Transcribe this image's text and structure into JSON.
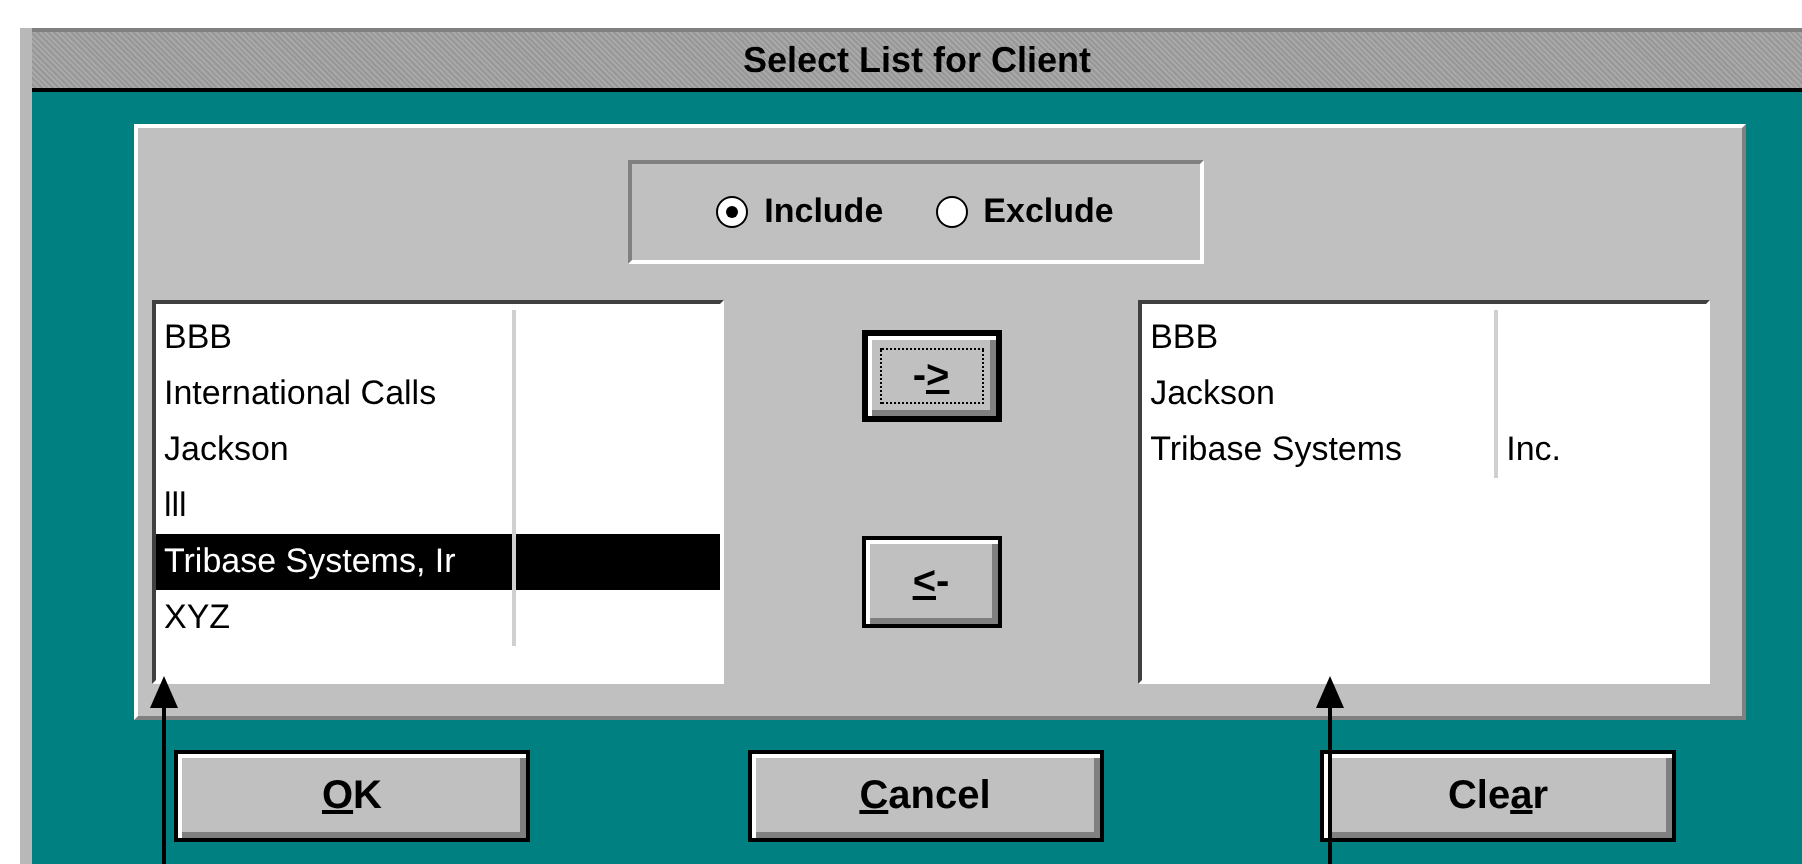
{
  "window": {
    "title": "Select List for Client"
  },
  "mode": [
    {
      "label": "Include",
      "selected": true
    },
    {
      "label": "Exclude",
      "selected": false
    }
  ],
  "available_list": {
    "rows": [
      {
        "column_1": "BBB",
        "selected": false
      },
      {
        "column_1": "International Calls",
        "selected": false
      },
      {
        "column_1": "Jackson",
        "selected": false
      },
      {
        "column_1": "lll",
        "selected": false
      },
      {
        "column_1": "Tribase Systems, Ir",
        "selected": true
      },
      {
        "column_1": "XYZ",
        "selected": false
      }
    ]
  },
  "move_buttons": [
    {
      "before": "-",
      "key": ">",
      "focused": true
    },
    {
      "key": "<",
      "after": "-",
      "focused": false
    }
  ],
  "selected_list": {
    "rows": [
      {
        "column_1": "BBB"
      },
      {
        "column_1": "Jackson"
      },
      {
        "column_1": "Tribase Systems",
        "column_2": "Inc."
      }
    ]
  },
  "buttons": [
    {
      "key": "O",
      "after": "K"
    },
    {
      "key": "C",
      "after": "ancel"
    },
    {
      "before": "Cle",
      "key": "a",
      "after": "r"
    }
  ]
}
